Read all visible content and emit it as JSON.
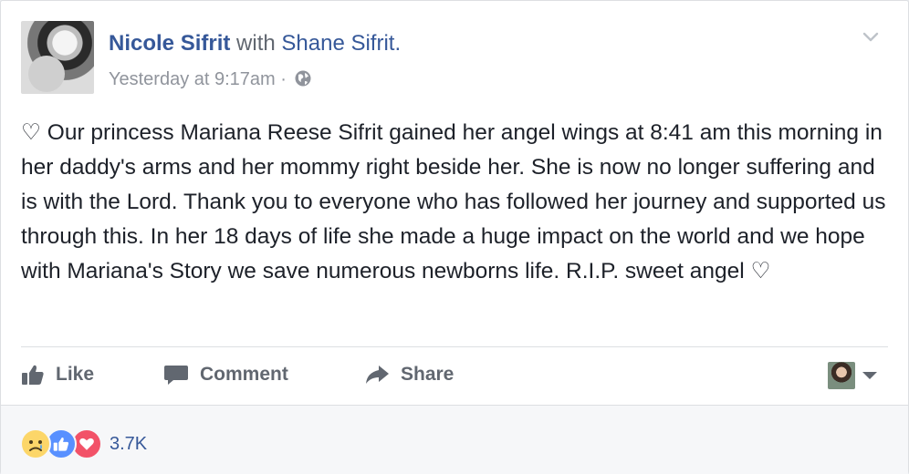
{
  "post": {
    "author": "Nicole Sifrit",
    "with_label": "with",
    "tagged": "Shane Sifrit.",
    "timestamp": "Yesterday at 9:17am",
    "separator": "·",
    "privacy_icon": "globe-icon",
    "text": "♡ Our princess Mariana Reese Sifrit gained her angel wings at 8:41 am this morning in her daddy's arms and her mommy right beside her. She is now no longer suffering and is with the Lord. Thank you to everyone who has followed her journey and supported us through this. In her 18 days of life she made a huge impact on the world and we hope with Mariana's Story we save numerous newborns life. R.I.P. sweet angel ♡"
  },
  "actions": {
    "like_label": "Like",
    "comment_label": "Comment",
    "share_label": "Share"
  },
  "reactions": {
    "icons": [
      "sad-reaction-icon",
      "like-reaction-icon",
      "love-reaction-icon"
    ],
    "count": "3.7K"
  },
  "colors": {
    "link": "#365899",
    "meta": "#90949c",
    "text": "#1d2129",
    "action": "#616770",
    "like_blue": "#5890ff",
    "love_red": "#f25268",
    "sad_yellow": "#fcd669"
  }
}
